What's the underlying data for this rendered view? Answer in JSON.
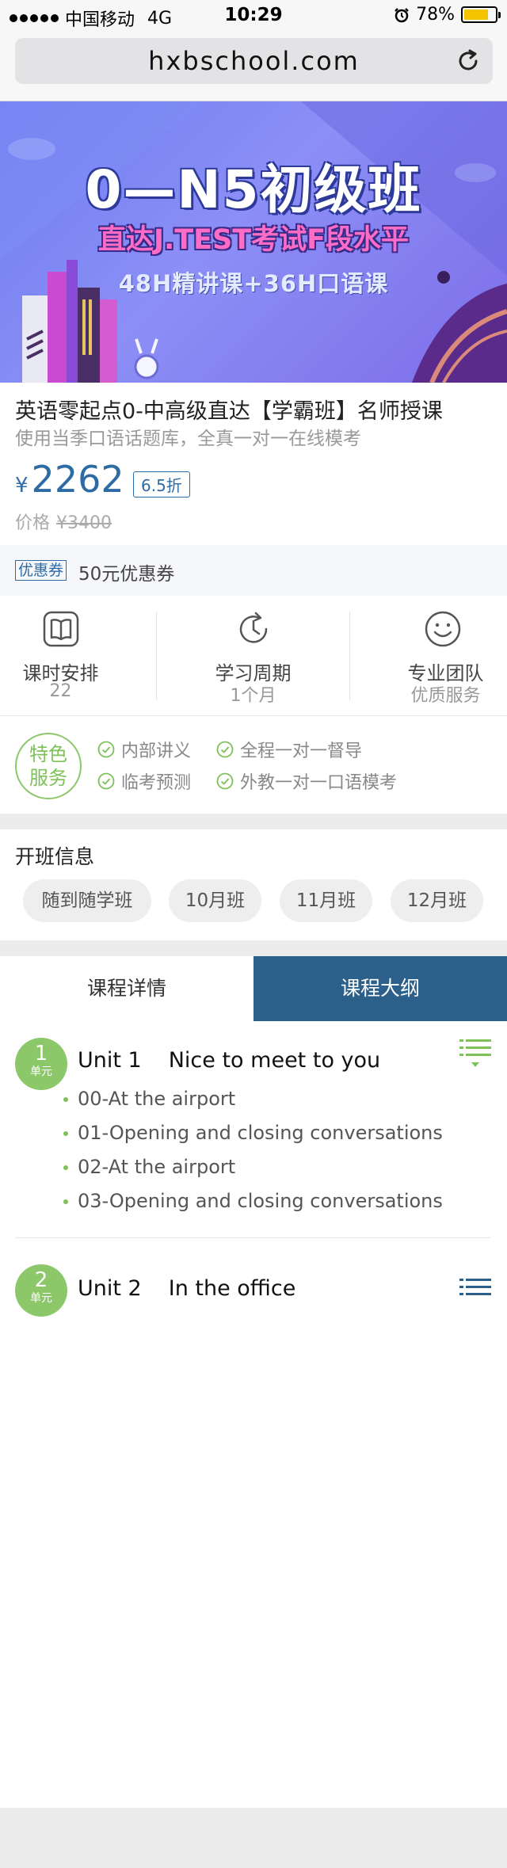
{
  "status": {
    "carrier": "中国移动",
    "network": "4G",
    "time": "10:29",
    "battery": "78%",
    "battery_level": 0.78
  },
  "browser": {
    "url": "hxbschool.com",
    "reload_icon": "reload-icon"
  },
  "banner": {
    "title": "0—N5初级班",
    "subtitle": "直达J.TEST考试F段水平",
    "subtitle2": "48H精讲课+36H口语课"
  },
  "course": {
    "title": "英语零起点0-中高级直达【学霸班】名师授课",
    "subtitle": "使用当季口语话题库，全真一对一在线模考",
    "currency": "¥",
    "price": "2262",
    "discount": "6.5折",
    "orig_label": "价格",
    "orig_price": "¥3400"
  },
  "coupon": {
    "tag": "优惠券",
    "text": "50元优惠券"
  },
  "info": [
    {
      "icon": "book-icon",
      "label": "课时安排",
      "value": "22"
    },
    {
      "icon": "clock-icon",
      "label": "学习周期",
      "value": "1个月"
    },
    {
      "icon": "smile-icon",
      "label": "专业团队",
      "value": "优质服务"
    }
  ],
  "features": {
    "badge_line1": "特色",
    "badge_line2": "服务",
    "items": [
      "内部讲义",
      "全程一对一督导",
      "临考预测",
      "外教一对一口语模考"
    ]
  },
  "class_info": {
    "title": "开班信息",
    "options": [
      "随到随学班",
      "10月班",
      "11月班",
      "12月班"
    ]
  },
  "tabs": {
    "details": "课程详情",
    "outline": "课程大纲",
    "active": "outline"
  },
  "units": [
    {
      "num": "1",
      "cap": "单元",
      "label": "Unit 1",
      "name": "Nice to meet to you",
      "lessons": [
        "00-At the airport",
        "01-Opening and closing conversations",
        "02-At the airport",
        "03-Opening and closing conversations"
      ]
    },
    {
      "num": "2",
      "cap": "单元",
      "label": "Unit 2",
      "name": "In the office",
      "lessons": []
    }
  ],
  "colors": {
    "accent_blue": "#2c5f8a",
    "price_blue": "#2d6ba5",
    "green": "#7dc158",
    "banner": "#7d86f0"
  }
}
